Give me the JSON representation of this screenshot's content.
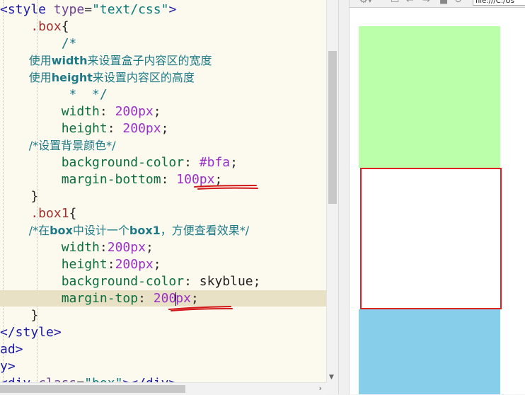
{
  "editor": {
    "lines": [
      [
        {
          "t": "<style ",
          "c": "tag"
        },
        {
          "t": "type",
          "c": "attr"
        },
        {
          "t": "=",
          "c": "punc"
        },
        {
          "t": "\"text/css\"",
          "c": "str"
        },
        {
          "t": ">",
          "c": "tag"
        }
      ],
      [
        {
          "t": "    .box",
          "c": "sel"
        },
        {
          "t": "{",
          "c": "punc"
        }
      ],
      [
        {
          "t": "        /*",
          "c": "cmt"
        }
      ],
      [
        {
          "t": "        使用",
          "c": "cmt"
        },
        {
          "t": "width",
          "c": "cmtb"
        },
        {
          "t": "来设置盒子内容区的宽度",
          "c": "cmt"
        }
      ],
      [
        {
          "t": "        使用",
          "c": "cmt"
        },
        {
          "t": "height",
          "c": "cmtb"
        },
        {
          "t": "来设置内容区的高度",
          "c": "cmt"
        }
      ],
      [
        {
          "t": "         *  */",
          "c": "cmt"
        }
      ],
      [
        {
          "t": "        width",
          "c": "prop"
        },
        {
          "t": ": ",
          "c": "punc"
        },
        {
          "t": "200",
          "c": "num"
        },
        {
          "t": "px",
          "c": "num"
        },
        {
          "t": ";",
          "c": "punc"
        }
      ],
      [
        {
          "t": "        height",
          "c": "prop"
        },
        {
          "t": ": ",
          "c": "punc"
        },
        {
          "t": "200",
          "c": "num"
        },
        {
          "t": "px",
          "c": "num"
        },
        {
          "t": ";",
          "c": "punc"
        }
      ],
      [
        {
          "t": "        /*设置背景颜色*/",
          "c": "cmt"
        }
      ],
      [
        {
          "t": "        background-color",
          "c": "prop"
        },
        {
          "t": ": ",
          "c": "punc"
        },
        {
          "t": "#bfa",
          "c": "num"
        },
        {
          "t": ";",
          "c": "punc"
        }
      ],
      [
        {
          "t": "        margin-bottom",
          "c": "prop"
        },
        {
          "t": ": ",
          "c": "punc"
        },
        {
          "t": "100",
          "c": "num"
        },
        {
          "t": "px",
          "c": "num"
        },
        {
          "t": ";",
          "c": "punc"
        }
      ],
      [
        {
          "t": "    }",
          "c": "punc"
        }
      ],
      [
        {
          "t": "    .box1",
          "c": "sel"
        },
        {
          "t": "{",
          "c": "punc"
        }
      ],
      [
        {
          "t": "        /*在",
          "c": "cmt"
        },
        {
          "t": "box",
          "c": "cmtb"
        },
        {
          "t": "中设计一个",
          "c": "cmt"
        },
        {
          "t": "box1",
          "c": "cmtb"
        },
        {
          "t": "，方便查看效果*/",
          "c": "cmt"
        }
      ],
      [
        {
          "t": "        width",
          "c": "prop"
        },
        {
          "t": ":",
          "c": "punc"
        },
        {
          "t": "200",
          "c": "num"
        },
        {
          "t": "px",
          "c": "num"
        },
        {
          "t": ";",
          "c": "punc"
        }
      ],
      [
        {
          "t": "        height",
          "c": "prop"
        },
        {
          "t": ":",
          "c": "punc"
        },
        {
          "t": "200",
          "c": "num"
        },
        {
          "t": "px",
          "c": "num"
        },
        {
          "t": ";",
          "c": "punc"
        }
      ],
      [
        {
          "t": "        background-color",
          "c": "prop"
        },
        {
          "t": ": ",
          "c": "punc"
        },
        {
          "t": "skyblue",
          "c": "val"
        },
        {
          "t": ";",
          "c": "punc"
        }
      ],
      [
        {
          "t": "        margin-top",
          "c": "prop"
        },
        {
          "t": ": ",
          "c": "punc"
        },
        {
          "t": "200",
          "c": "num"
        },
        {
          "t": "CARET",
          "c": "caret"
        },
        {
          "t": "px",
          "c": "num"
        },
        {
          "t": ";",
          "c": "punc"
        }
      ],
      [
        {
          "t": "    }",
          "c": "punc"
        }
      ],
      [
        {
          "t": "</style>",
          "c": "tag"
        }
      ],
      [
        {
          "t": "ad>",
          "c": "tag"
        }
      ],
      [
        {
          "t": "y>",
          "c": "tag"
        }
      ],
      [
        {
          "t": "<div ",
          "c": "tag"
        },
        {
          "t": "class",
          "c": "attr"
        },
        {
          "t": "=",
          "c": "punc"
        },
        {
          "t": "\"box\"",
          "c": "str"
        },
        {
          "t": "></div>",
          "c": "tag"
        }
      ]
    ]
  },
  "browser": {
    "address": "file:///C:/Us"
  },
  "colors": {
    "box_bg": "#bbffaa",
    "box1_bg": "#87ceeb",
    "outline": "#e02020",
    "annotation": "#d01818"
  }
}
